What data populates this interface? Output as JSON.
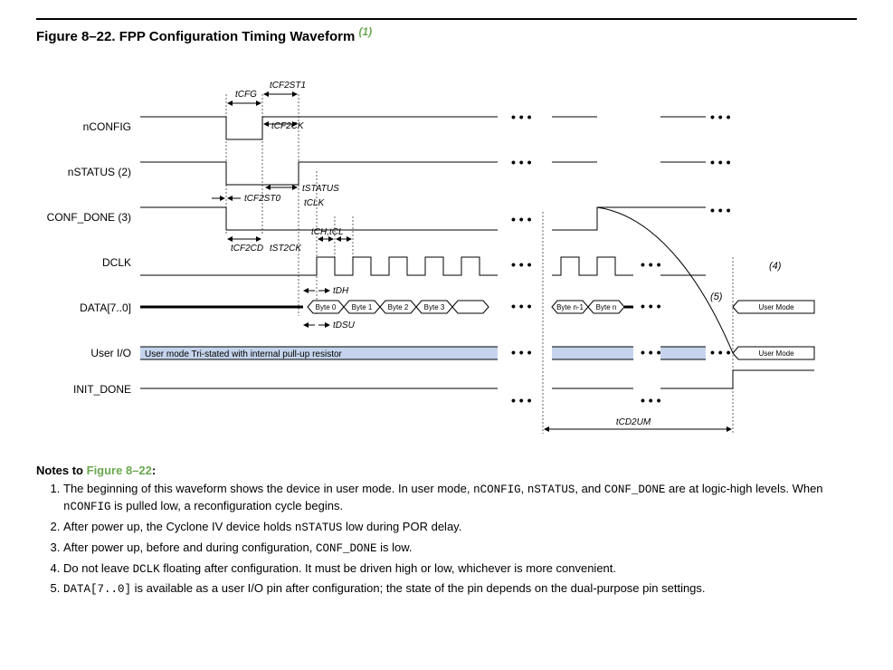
{
  "figure": {
    "number": "Figure 8–22.",
    "title": "FPP Configuration Timing Waveform",
    "superscript": "(1)"
  },
  "signals": {
    "nconfig": "nCONFIG",
    "nstatus": "nSTATUS (2)",
    "conf_done": "CONF_DONE (3)",
    "dclk": "DCLK",
    "data": "DATA[7..0]",
    "user_io": "User I/O",
    "init_done": "INIT_DONE"
  },
  "timing_params": {
    "tcfg": "tCFG",
    "tcf2st1": "tCF2ST1",
    "tcf2ck": "tCF2CK",
    "tstatus": "tSTATUS",
    "tcf2st0": "tCF2ST0",
    "tclk": "tCLK",
    "tcf2cd": "tCF2CD",
    "tst2ck": "tST2CK",
    "tchcl": "tCH,tCL",
    "tdh": "tDH",
    "tdsu": "tDSU",
    "tcd2um": "tCD2UM"
  },
  "data_bytes": {
    "b0": "Byte 0",
    "b1": "Byte 1",
    "b2": "Byte 2",
    "b3": "Byte 3",
    "bn1": "Byte n-1",
    "bn": "Byte n"
  },
  "annotations": {
    "user_mode_tristate": "User mode Tri-stated with internal pull-up resistor",
    "user_mode": "User Mode",
    "note4": "(4)",
    "note5": "(5)"
  },
  "notes": {
    "heading_prefix": "Notes to ",
    "heading_link": "Figure 8–22",
    "heading_suffix": ":",
    "n1_a": "The beginning of this waveform shows the device in user mode. In user mode, ",
    "n1_sig1": "nCONFIG",
    "n1_b": ", ",
    "n1_sig2": "nSTATUS",
    "n1_c": ", and ",
    "n1_sig3": "CONF_DONE",
    "n1_d": " are at logic-high levels. When ",
    "n1_sig4": "nCONFIG",
    "n1_e": " is pulled low, a reconfiguration cycle begins.",
    "n2_a": "After power up, the Cyclone IV device holds ",
    "n2_sig": "nSTATUS",
    "n2_b": " low during POR delay.",
    "n3_a": "After power up, before and during configuration, ",
    "n3_sig": "CONF_DONE",
    "n3_b": " is low.",
    "n4_a": "Do not leave ",
    "n4_sig": "DCLK",
    "n4_b": " floating after configuration. It must be driven high or low, whichever is more convenient.",
    "n5_sig": "DATA[7..0]",
    "n5_a": " is available as a user I/O pin after configuration; the state of the pin depends on the dual-purpose pin settings."
  }
}
